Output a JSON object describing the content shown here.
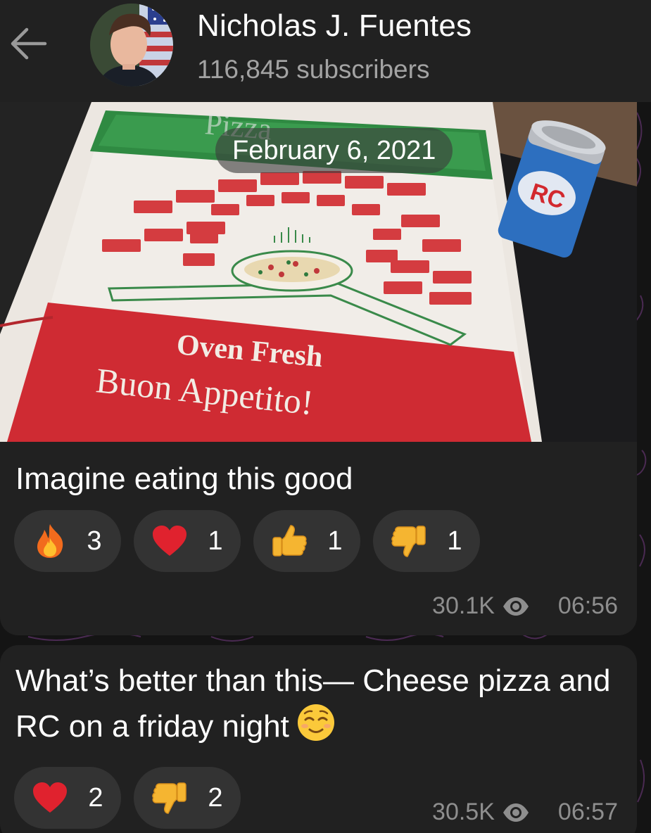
{
  "header": {
    "channel_name": "Nicholas J. Fuentes",
    "subscribers": "116,845 subscribers"
  },
  "date_separator": "February 6, 2021",
  "photo": {
    "box_text_top": "Pizza",
    "box_text_line1": "Oven Fresh",
    "box_text_line2": "Buon Appetito!",
    "can_text": "RC"
  },
  "messages": [
    {
      "text": "Imagine eating this good",
      "reactions": [
        {
          "icon": "fire-icon",
          "count": "3"
        },
        {
          "icon": "red-heart-icon",
          "count": "1"
        },
        {
          "icon": "thumbs-up-icon",
          "count": "1"
        },
        {
          "icon": "thumbs-down-icon",
          "count": "1"
        }
      ],
      "views": "30.1K",
      "time": "06:56"
    },
    {
      "text": "What’s better than this— Cheese pizza and RC on a friday night",
      "inline_emoji": "relieved-face-icon",
      "reactions": [
        {
          "icon": "red-heart-icon",
          "count": "2"
        },
        {
          "icon": "thumbs-down-icon",
          "count": "2"
        }
      ],
      "views": "30.5K",
      "time": "06:57"
    }
  ],
  "colors": {
    "background": "#141414",
    "header": "#212121",
    "bubble": "#212121",
    "reaction_pill": "#333333",
    "secondary_text": "#8e8e8e",
    "subscriber_text": "#a3a3a3"
  }
}
